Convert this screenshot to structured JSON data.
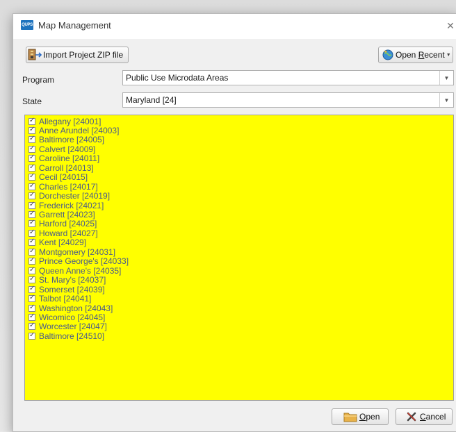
{
  "window": {
    "title": "Map Management",
    "app_icon_text": "QUPS"
  },
  "toolbar": {
    "import_label": "Import Project ZIP file",
    "open_recent_label": "Open Recent",
    "open_recent_underline": "R"
  },
  "form": {
    "program_label": "Program",
    "program_value": "Public Use Microdata Areas",
    "state_label": "State",
    "state_value": "Maryland [24]"
  },
  "list": {
    "highlight_color": "#ffff00",
    "items": [
      {
        "label": "Allegany [24001]",
        "checked": true
      },
      {
        "label": "Anne Arundel [24003]",
        "checked": true
      },
      {
        "label": "Baltimore [24005]",
        "checked": true
      },
      {
        "label": "Calvert [24009]",
        "checked": true
      },
      {
        "label": "Caroline [24011]",
        "checked": true
      },
      {
        "label": "Carroll [24013]",
        "checked": true
      },
      {
        "label": "Cecil [24015]",
        "checked": true
      },
      {
        "label": "Charles [24017]",
        "checked": true
      },
      {
        "label": "Dorchester [24019]",
        "checked": true
      },
      {
        "label": "Frederick [24021]",
        "checked": true
      },
      {
        "label": "Garrett [24023]",
        "checked": true
      },
      {
        "label": "Harford [24025]",
        "checked": true
      },
      {
        "label": "Howard [24027]",
        "checked": true
      },
      {
        "label": "Kent [24029]",
        "checked": true
      },
      {
        "label": "Montgomery [24031]",
        "checked": true
      },
      {
        "label": "Prince George's [24033]",
        "checked": true
      },
      {
        "label": "Queen Anne's [24035]",
        "checked": true
      },
      {
        "label": "St. Mary's [24037]",
        "checked": true
      },
      {
        "label": "Somerset [24039]",
        "checked": true
      },
      {
        "label": "Talbot [24041]",
        "checked": true
      },
      {
        "label": "Washington [24043]",
        "checked": true
      },
      {
        "label": "Wicomico [24045]",
        "checked": true
      },
      {
        "label": "Worcester [24047]",
        "checked": true
      },
      {
        "label": "Baltimore [24510]",
        "checked": true
      }
    ]
  },
  "footer": {
    "open_label": "Open",
    "cancel_label": "Cancel"
  }
}
